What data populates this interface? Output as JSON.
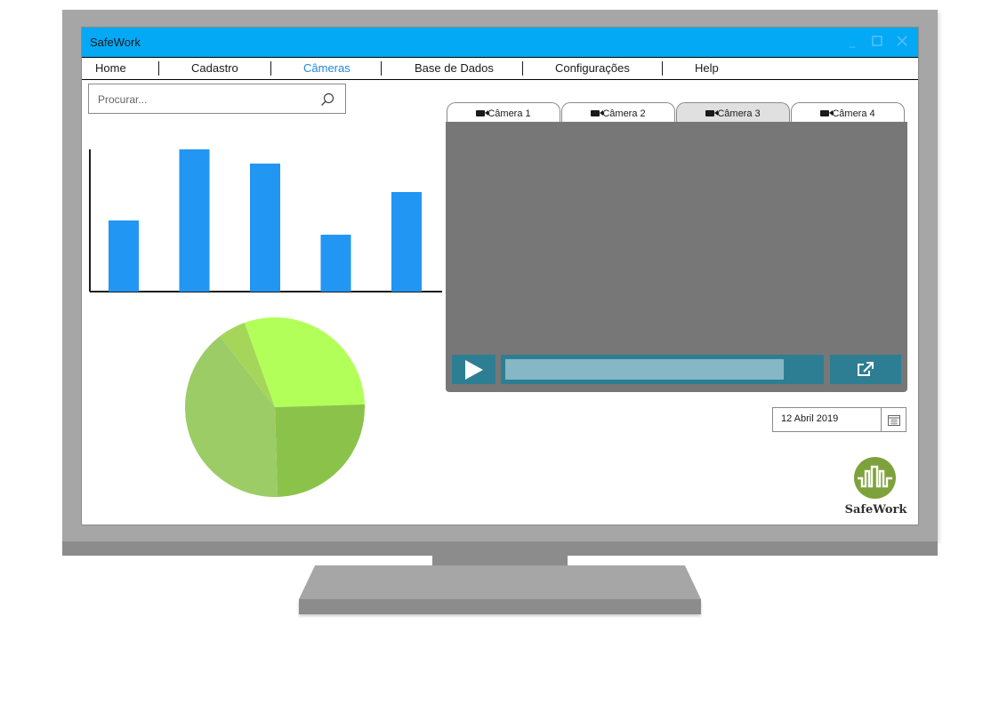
{
  "window": {
    "title": "SafeWork",
    "controls": [
      "minimize-icon",
      "maximize-icon",
      "close-icon"
    ]
  },
  "menu": {
    "items": [
      "Home",
      "Cadastro",
      "Câmeras",
      "Base de Dados",
      "Configurações",
      "Help"
    ],
    "active": "Câmeras"
  },
  "search": {
    "placeholder": "Procurar..."
  },
  "chart_data": [
    {
      "type": "bar",
      "categories": [
        "",
        "",
        "",
        "",
        ""
      ],
      "values": [
        50,
        100,
        90,
        40,
        70
      ],
      "ylim": [
        0,
        100
      ],
      "color": "#2196f3"
    },
    {
      "type": "pie",
      "values": [
        30,
        25,
        40,
        5
      ],
      "colors": [
        "#b2ff59",
        "#8bc34a",
        "#9ccc65",
        "#a5d65a"
      ]
    }
  ],
  "camera_tabs": {
    "items": [
      "Câmera 1",
      "Câmera 2",
      "Câmera 3",
      "Câmera 4"
    ],
    "active": "Câmera 3",
    "icon": "video-camera-icon"
  },
  "player": {
    "progress": 0.875,
    "play_icon": "play-icon",
    "share_icon": "external-link-icon"
  },
  "date": {
    "value": "12 Abril 2019",
    "icon": "calendar-icon"
  },
  "logo": {
    "text": "SafeWork"
  },
  "colors": {
    "titlebar": "#03a9f4",
    "active_menu": "#1e88d6",
    "player_controls": "#2d7e93",
    "video_bg": "#777777",
    "logo_green": "#7ea23b"
  }
}
